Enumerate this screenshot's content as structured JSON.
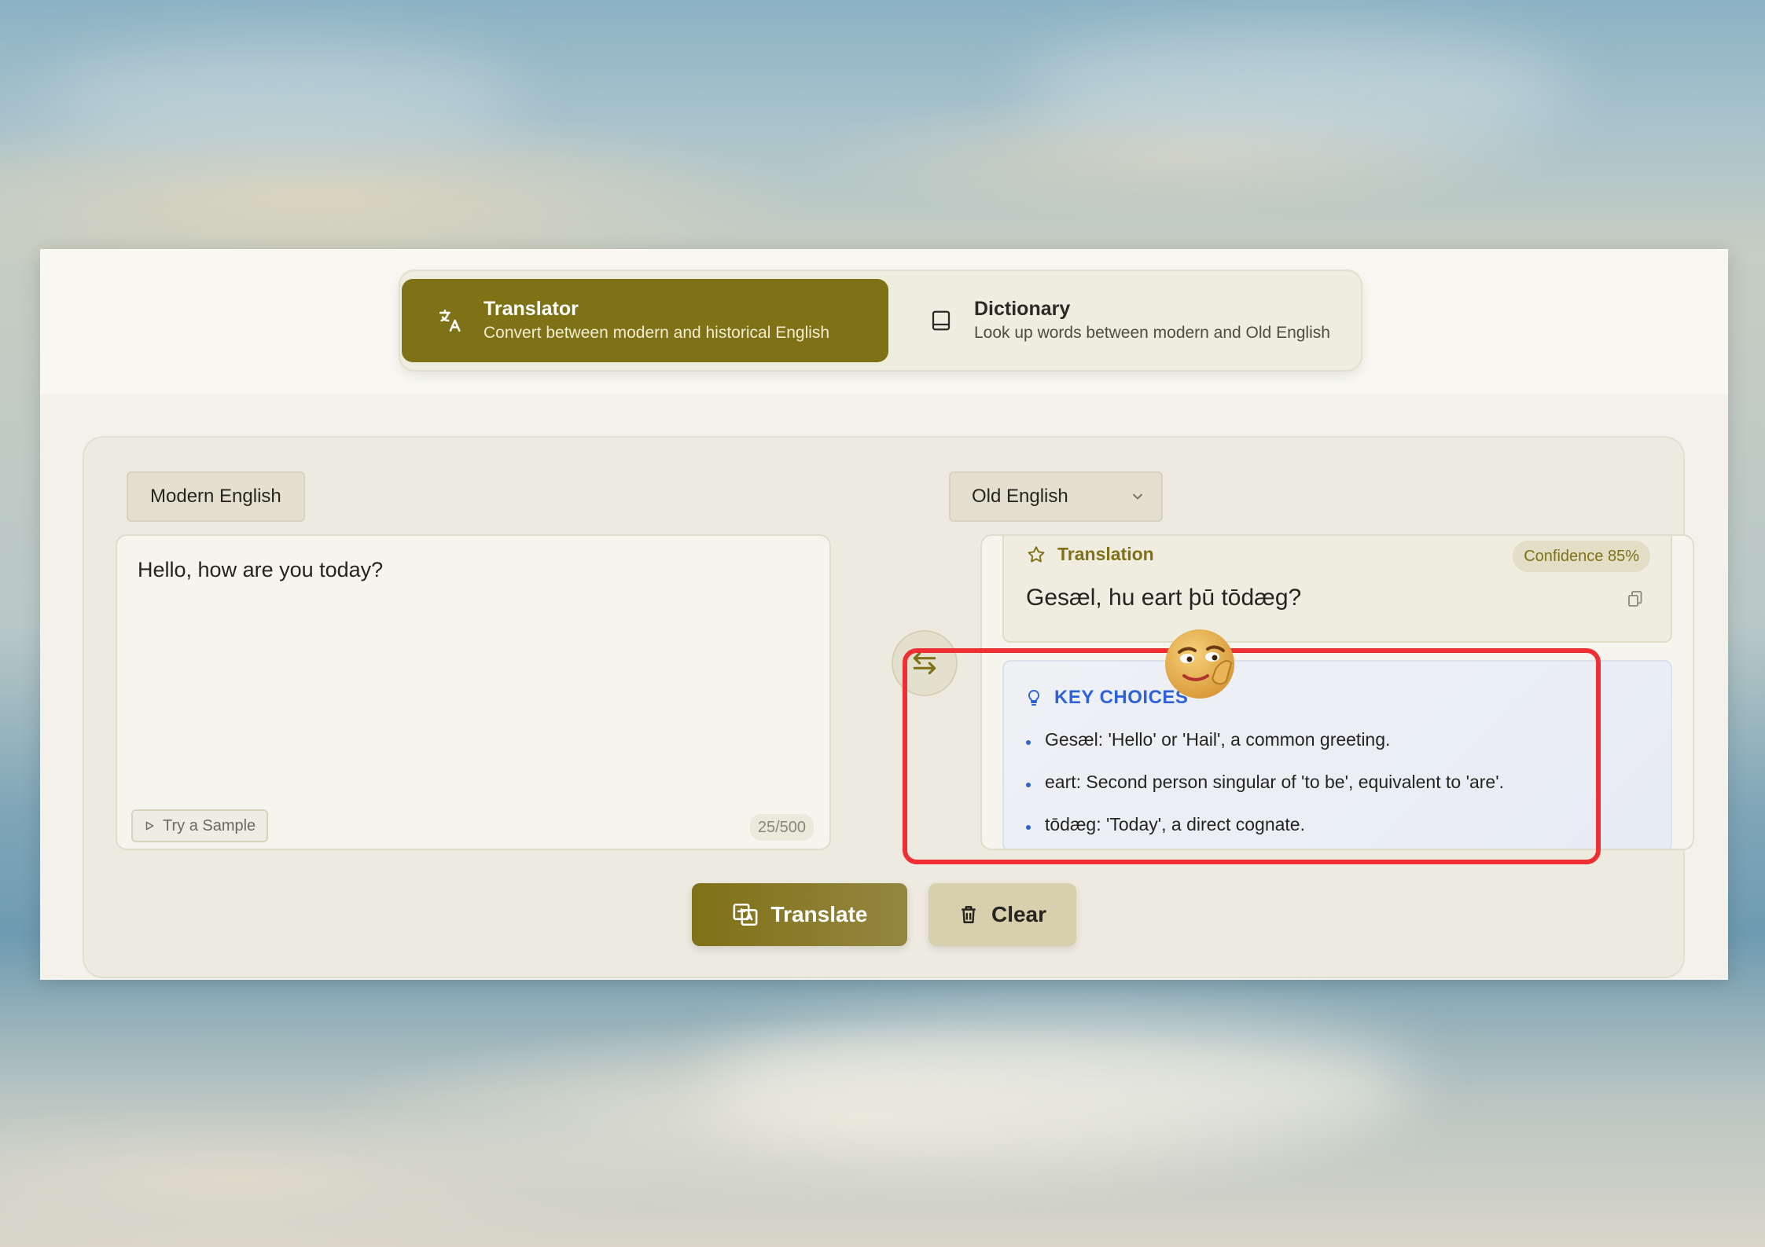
{
  "tabs": [
    {
      "title": "Translator",
      "subtitle": "Convert between modern and historical English",
      "icon": "translate-icon",
      "active": true
    },
    {
      "title": "Dictionary",
      "subtitle": "Look up words between modern and Old English",
      "icon": "book-icon",
      "active": false
    }
  ],
  "source": {
    "language": "Modern English",
    "text": "Hello, how are you today?",
    "sample_label": "Try a Sample",
    "char_count": "25/500"
  },
  "target": {
    "language": "Old English",
    "heading": "Translation",
    "confidence": "Confidence 85%",
    "text": "Gesæl, hu eart þū tōdæg?"
  },
  "key_choices": {
    "heading": "KEY CHOICES",
    "items": [
      "Gesæl: 'Hello' or 'Hail', a common greeting.",
      "eart: Second person singular of 'to be', equivalent to 'are'.",
      "tōdæg: 'Today', a direct cognate."
    ]
  },
  "actions": {
    "translate_label": "Translate",
    "clear_label": "Clear"
  },
  "colors": {
    "accent": "#7f7116",
    "key_choices": "#2d62d8",
    "highlight": "#ef2f33"
  }
}
